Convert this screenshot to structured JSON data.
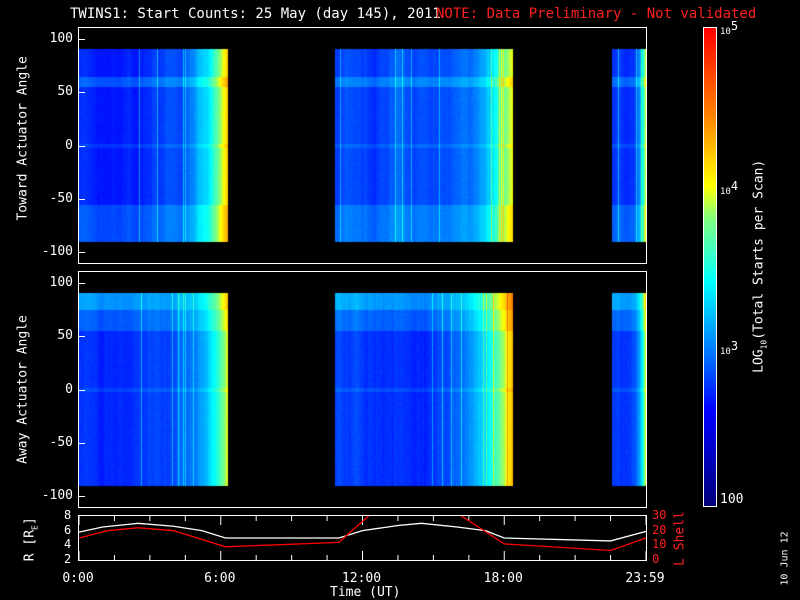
{
  "title": "TWINS1: Start Counts: 25 May (day 145), 2011",
  "note": "NOTE: Data Preliminary - Not validated",
  "date_stamp": "10 Jun 12",
  "chart_data": [
    {
      "type": "heatmap",
      "name": "toward",
      "ylabel": "Toward Actuator Angle",
      "ylim": [
        -110,
        110
      ],
      "yticks": [
        "100",
        "50",
        "0",
        "-50",
        "-100"
      ],
      "ytick_values": [
        100,
        50,
        0,
        -50,
        -100
      ],
      "data_y_range": [
        -90,
        90
      ],
      "xlim_hours": [
        0,
        24
      ],
      "data_segments_hours": [
        [
          0,
          6.3
        ],
        [
          10.85,
          18.35
        ],
        [
          22.55,
          24
        ]
      ],
      "colorscale_log10_range": [
        2,
        5
      ]
    },
    {
      "type": "heatmap",
      "name": "away",
      "ylabel": "Away Actuator Angle",
      "ylim": [
        -110,
        110
      ],
      "yticks": [
        "100",
        "50",
        "0",
        "-50",
        "-100"
      ],
      "ytick_values": [
        100,
        50,
        0,
        -50,
        -100
      ],
      "data_y_range": [
        -90,
        90
      ],
      "xlim_hours": [
        0,
        24
      ],
      "data_segments_hours": [
        [
          0,
          6.3
        ],
        [
          10.85,
          18.35
        ],
        [
          22.55,
          24
        ]
      ],
      "colorscale_log10_range": [
        2,
        5
      ]
    },
    {
      "type": "line",
      "name": "orbit",
      "ylabel_left": "R [R",
      "ylabel_left_sub": "E",
      "ylabel_left_end": "]",
      "ylabel_right": "L Shell",
      "ylim_left": [
        2,
        8
      ],
      "ylim_right": [
        0,
        30
      ],
      "yticks_left": [
        "8",
        "6",
        "4",
        "2"
      ],
      "yticks_right": [
        "30",
        "20",
        "10",
        "0"
      ],
      "xlabel": "Time (UT)",
      "xticks": [
        "0:00",
        "6:00",
        "12:00",
        "18:00",
        "23:59"
      ],
      "xtick_hours": [
        0,
        6,
        12,
        18,
        24
      ],
      "series": [
        {
          "name": "R",
          "color": "#ffffff",
          "x": [
            0,
            1,
            2.5,
            4,
            5.2,
            6.2,
            11,
            12,
            13.5,
            14.5,
            16,
            17.2,
            18,
            22.5,
            24
          ],
          "y": [
            5.8,
            6.5,
            7,
            6.6,
            6,
            5,
            5,
            6,
            6.7,
            7,
            6.5,
            6,
            5,
            4.6,
            5.9
          ]
        },
        {
          "name": "L Shell",
          "color": "#ff0000",
          "x": [
            0,
            1.2,
            2.5,
            4,
            6.2,
            11,
            12.4,
            16,
            18,
            22.5,
            24
          ],
          "y": [
            15,
            20,
            22,
            20,
            9,
            12,
            32,
            32,
            11,
            6.5,
            15
          ]
        }
      ]
    }
  ],
  "colorbar": {
    "label": "LOG",
    "label_sub": "10",
    "label_end": "(Total Starts per Scan)",
    "ticks": [
      {
        "base": "10",
        "exp": "5",
        "value": 100000
      },
      {
        "base": "10",
        "exp": "4",
        "value": 10000
      },
      {
        "base": "10",
        "exp": "3",
        "value": 1000
      }
    ],
    "min_label": "100"
  }
}
